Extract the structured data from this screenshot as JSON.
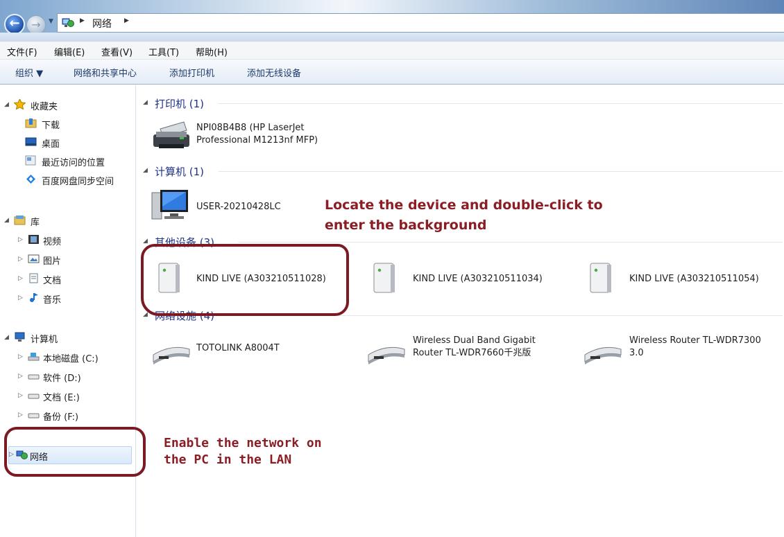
{
  "address_bar": {
    "crumb": "网络"
  },
  "menu": [
    "文件(F)",
    "编辑(E)",
    "查看(V)",
    "工具(T)",
    "帮助(H)"
  ],
  "commands": {
    "organize": "组织 ▼",
    "network_center": "网络和共享中心",
    "add_printer": "添加打印机",
    "add_wireless": "添加无线设备"
  },
  "nav": {
    "favorites": "收藏夹",
    "downloads": "下载",
    "desktop": "桌面",
    "recent": "最近访问的位置",
    "baidu": "百度网盘同步空间",
    "libraries": "库",
    "videos": "视频",
    "pictures": "图片",
    "documents": "文档",
    "music": "音乐",
    "computer": "计算机",
    "drive_c": "本地磁盘 (C:)",
    "drive_d": "软件 (D:)",
    "drive_e": "文档 (E:)",
    "drive_f": "备份 (F:)",
    "network": "网络"
  },
  "groups": {
    "printers": "打印机 (1)",
    "computers": "计算机 (1)",
    "other": "其他设备 (3)",
    "infra": "网络设施 (4)"
  },
  "items": {
    "printer_line1": "NPI08B4B8 (HP LaserJet",
    "printer_line2": "Professional M1213nf MFP)",
    "computer": "USER-20210428LC",
    "device1": "KIND LIVE (A303210511028)",
    "device2": "KIND LIVE (A303210511034)",
    "device3": "KIND LIVE (A303210511054)",
    "router1": "TOTOLINK A8004T",
    "router2_line1": "Wireless Dual Band Gigabit",
    "router2_line2": "Router TL-WDR7660千兆版",
    "router3_line1": "Wireless Router TL-WDR7300",
    "router3_line2": "3.0"
  },
  "annotations": {
    "device_note_line1": "Locate the device and double-click to",
    "device_note_line2": "enter the background",
    "network_note_line1": "Enable the network on",
    "network_note_line2": "the PC in the LAN"
  },
  "colors": {
    "annotation": "#8b1d24",
    "group_header": "#1e3287",
    "command_text": "#1e3a6b"
  }
}
